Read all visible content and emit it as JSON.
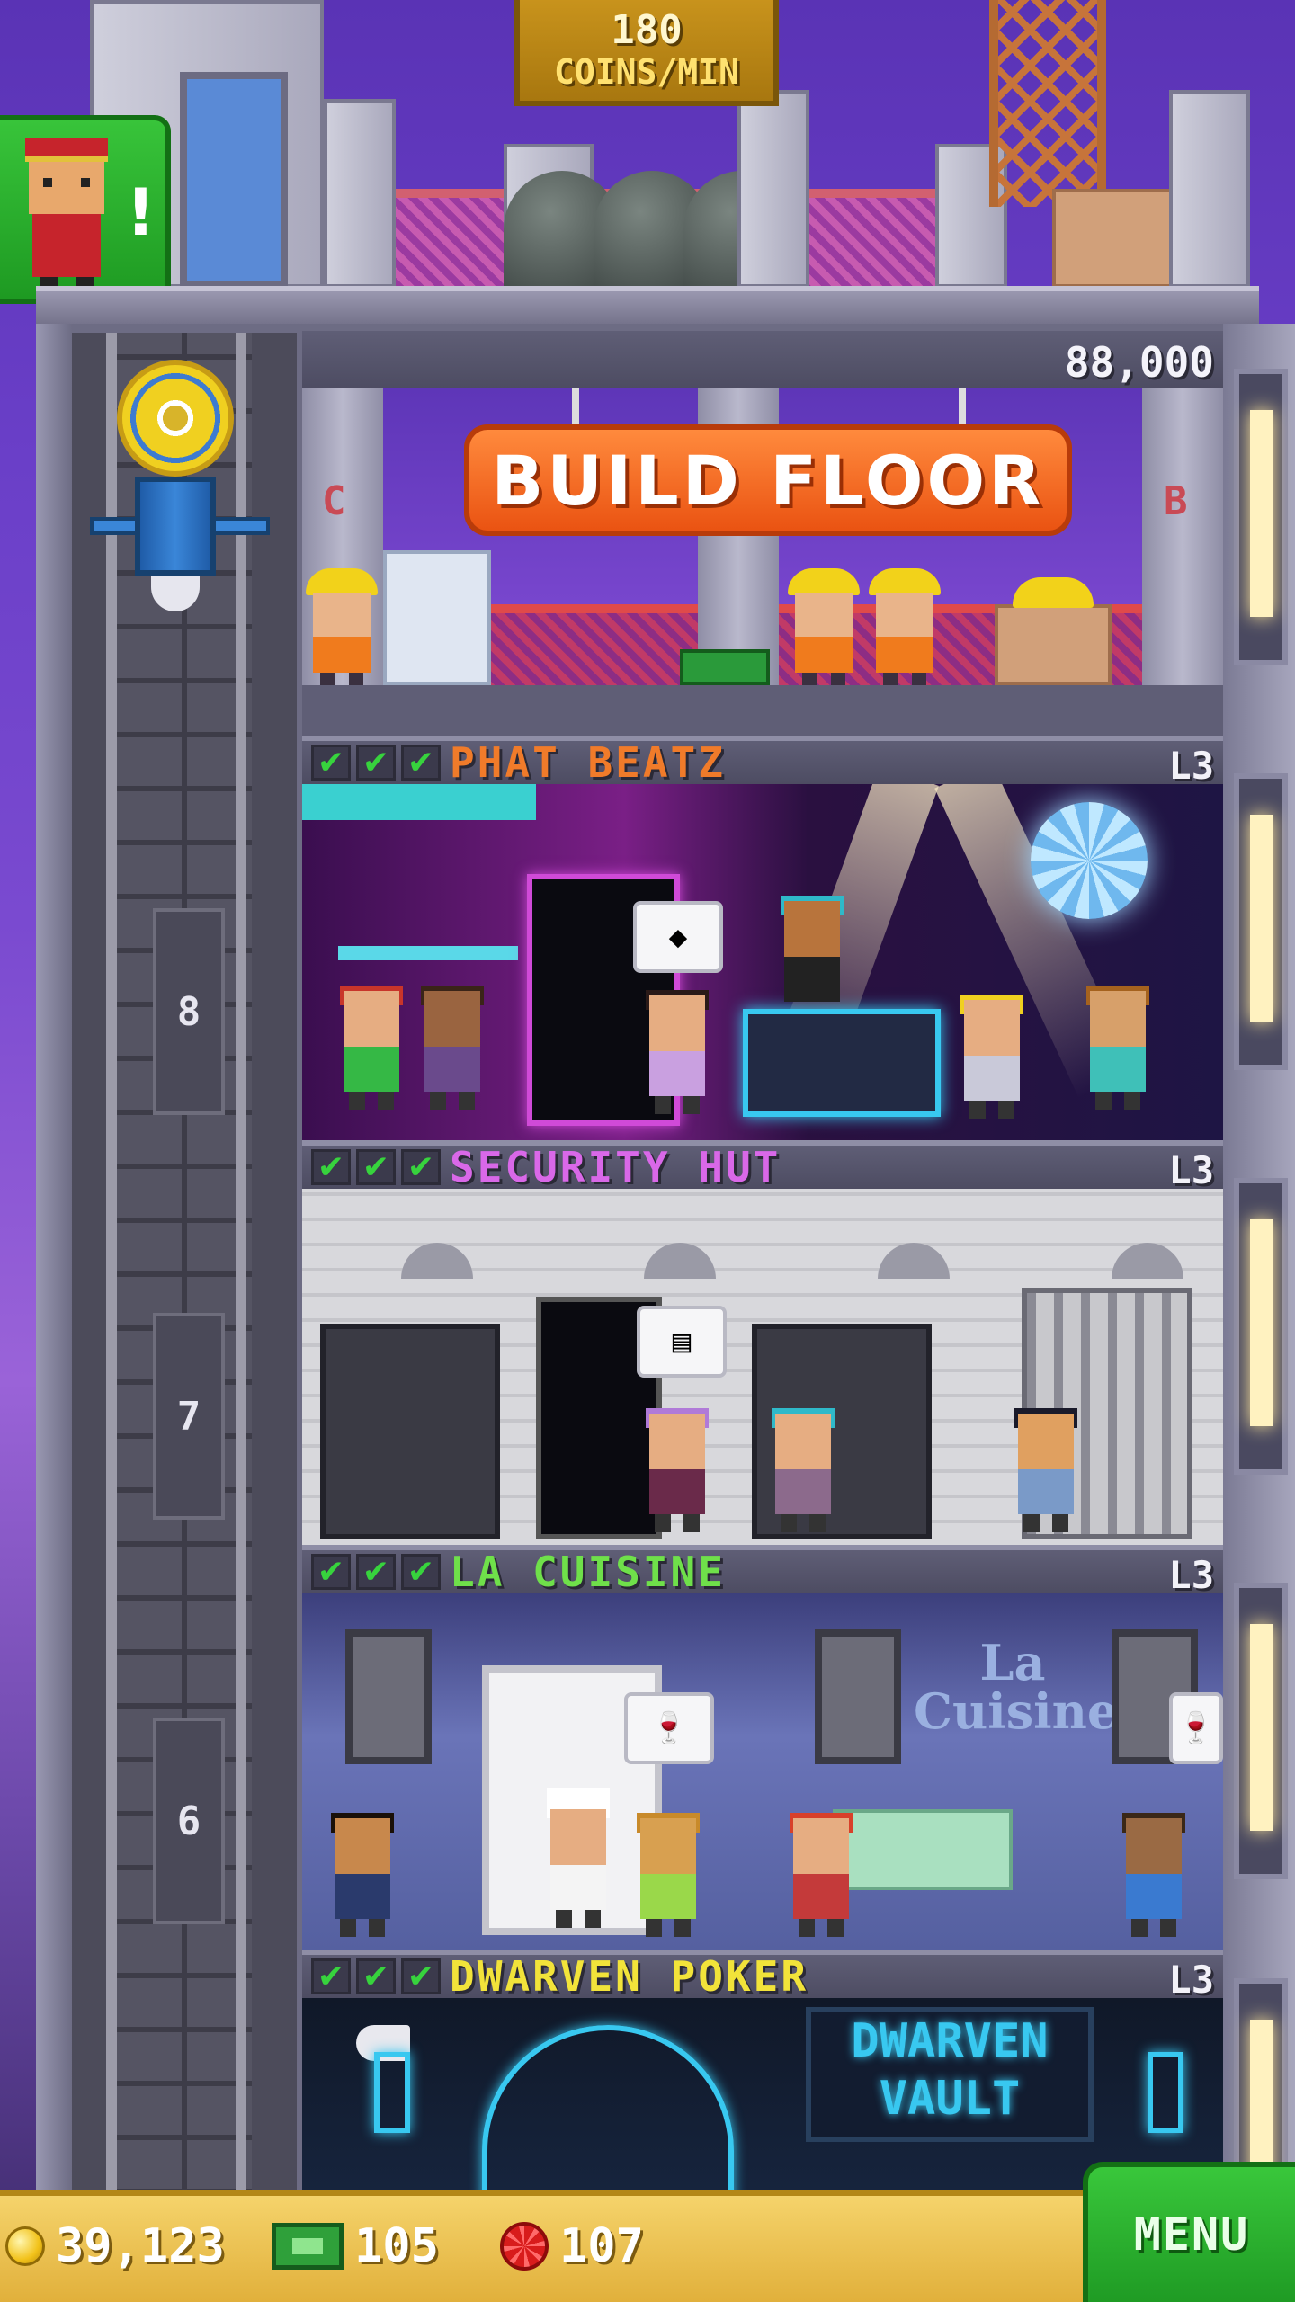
{
  "hud": {
    "coins_per_min_value": "180",
    "coins_per_min_label": "COINS/MIN"
  },
  "bellhop": {
    "icon": "bellhop-icon",
    "alert": "!"
  },
  "build": {
    "cost": "88,000",
    "button_label": "BUILD FLOOR",
    "sign_left": "C",
    "sign_right": "B"
  },
  "elevator": {
    "floor_numbers": [
      "8",
      "7",
      "6"
    ]
  },
  "floors": [
    {
      "name": "PHAT BEATZ",
      "level": "L3",
      "stars": 3,
      "color": "#f07b2a"
    },
    {
      "name": "SECURITY HUT",
      "level": "L3",
      "stars": 3,
      "color": "#d968e8"
    },
    {
      "name": "LA CUISINE",
      "level": "L3",
      "stars": 3,
      "color": "#6fe04a"
    },
    {
      "name": "DWARVEN POKER",
      "level": "L3",
      "stars": 3,
      "color": "#f2e33a"
    }
  ],
  "room_signs": {
    "cuisine_line1": "La",
    "cuisine_line2": "Cuisine",
    "poker_line1": "DWARVEN",
    "poker_line2": "VAULT"
  },
  "bottom_bar": {
    "coins": "39,123",
    "bux": "105",
    "chips": "107",
    "menu_label": "MENU"
  }
}
